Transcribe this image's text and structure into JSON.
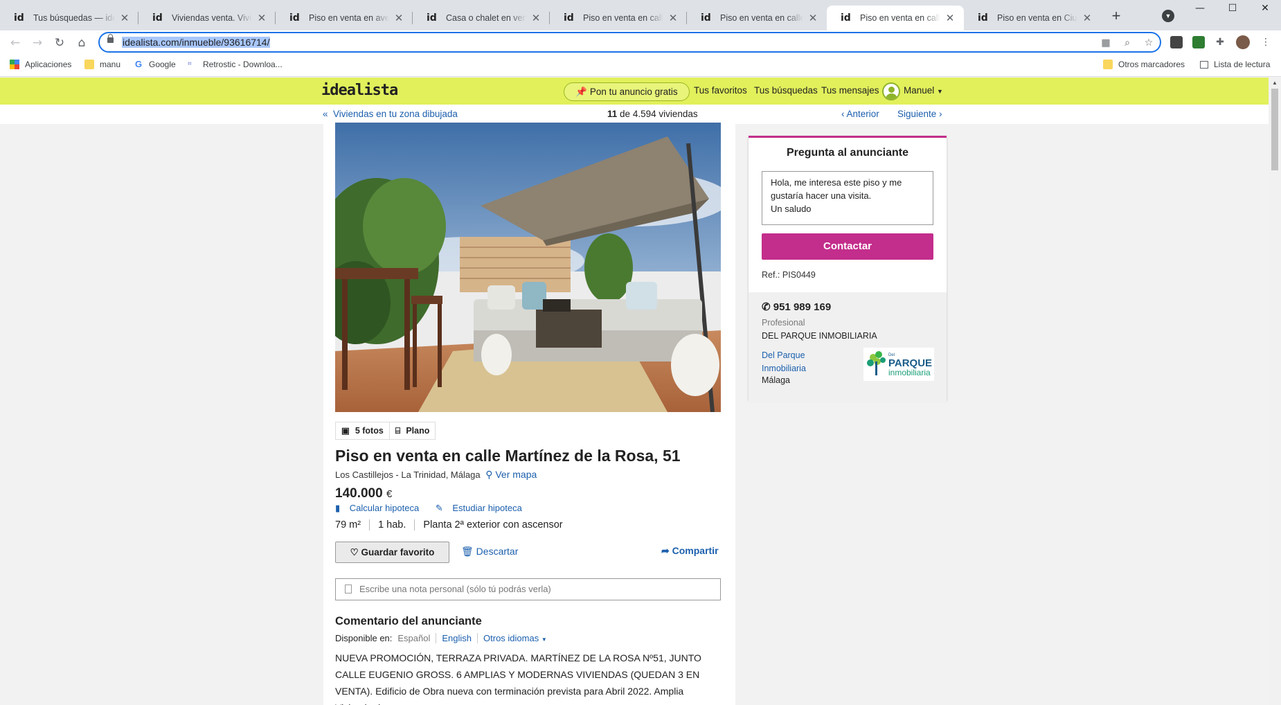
{
  "browser": {
    "tabs": [
      {
        "title": "Tus búsquedas — idealista"
      },
      {
        "title": "Viviendas venta. Viviendas"
      },
      {
        "title": "Piso en venta en avenida"
      },
      {
        "title": "Casa o chalet en venta en"
      },
      {
        "title": "Piso en venta en calle Ca"
      },
      {
        "title": "Piso en venta en calle Cla"
      },
      {
        "title": "Piso en venta en calle Ma"
      },
      {
        "title": "Piso en venta en Ciudad"
      }
    ],
    "favicon_text": "id",
    "active_tab_index": 6,
    "url": "idealista.com/inmueble/93616714/",
    "bookmarks": {
      "apps": "Aplicaciones",
      "manu": "manu",
      "google": "Google",
      "retrostic": "Retrostic - Downloa...",
      "others": "Otros marcadores",
      "reading_list": "Lista de lectura"
    }
  },
  "header": {
    "logo": "idealista",
    "post_ad": "Pon tu anuncio gratis",
    "favorites": "Tus favoritos",
    "searches": "Tus búsquedas",
    "messages": "Tus mensajes",
    "user": "Manuel"
  },
  "subnav": {
    "back": "Viviendas en tu zona dibujada",
    "position": "11",
    "total": "de 4.594 viviendas",
    "prev": "Anterior",
    "next": "Siguiente"
  },
  "listing": {
    "photos": "5 fotos",
    "plan": "Plano",
    "title": "Piso en venta en calle Martínez de la Rosa, 51",
    "location": "Los Castillejos - La Trinidad, Málaga",
    "map": "Ver mapa",
    "price": "140.000",
    "currency": "€",
    "calc_mortgage": "Calcular hipoteca",
    "study_mortgage": "Estudiar hipoteca",
    "features": [
      "79 m²",
      "1 hab.",
      "Planta 2ª exterior con ascensor"
    ],
    "save_fav": "Guardar favorito",
    "discard": "Descartar",
    "share": "Compartir",
    "note_placeholder": "Escribe una nota personal (sólo tú podrás verla)",
    "comment_title": "Comentario del anunciante",
    "available_in": "Disponible en:",
    "lang_current": "Español",
    "lang_english": "English",
    "lang_others": "Otros idiomas",
    "description": "NUEVA PROMOCIÓN, TERRAZA PRIVADA. MARTÍNEZ DE LA ROSA Nº51, JUNTO CALLE EUGENIO GROSS. 6 AMPLIAS Y MODERNAS VIVIENDAS (QUEDAN 3 EN VENTA). Edificio de Obra nueva con terminación prevista para Abril 2022. Amplia Vivienda de"
  },
  "contact": {
    "title": "Pregunta al anunciante",
    "message": "Hola, me interesa este piso y me gustaría hacer una visita.\nUn saludo",
    "button": "Contactar",
    "ref": "Ref.: PIS0449",
    "phone": "951 989 169",
    "type": "Profesional",
    "agency": "DEL PARQUE INMOBILIARIA",
    "agency_link": "Del Parque Inmobiliaria",
    "city": "Málaga",
    "logo_text_top": "PARQUE",
    "logo_text_bottom": "inmobiliaria",
    "logo_text_small": "Del"
  },
  "colors": {
    "brand_yellow": "#e1f05b",
    "accent_magenta": "#c32d8b",
    "link_blue": "#1b5fad"
  }
}
